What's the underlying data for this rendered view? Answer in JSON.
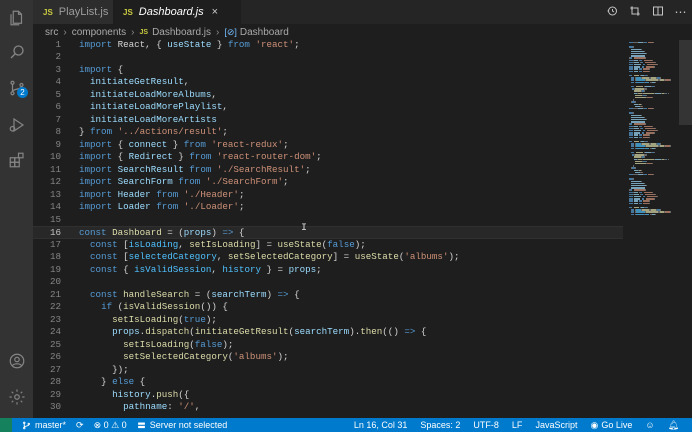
{
  "tabs": [
    {
      "icon": "JS",
      "label": "PlayList.js"
    },
    {
      "icon": "JS",
      "label": "Dashboard.js",
      "close": "×"
    }
  ],
  "breadcrumb": {
    "parts": [
      "src",
      "components"
    ],
    "file_icon": "JS",
    "file": "Dashboard.js",
    "symbol": "Dashboard"
  },
  "activity_bar": {
    "icons": [
      "files-icon",
      "search-icon",
      "source-control-icon",
      "run-debug-icon",
      "extensions-icon",
      "accounts-icon",
      "settings-gear-icon"
    ],
    "scm_badge": "2"
  },
  "editor": {
    "current_line": 16,
    "lines": [
      {
        "n": "1",
        "tokens": [
          [
            "k",
            "import"
          ],
          [
            "p",
            " React, { "
          ],
          [
            "v",
            "useState"
          ],
          [
            "p",
            " } "
          ],
          [
            "k",
            "from"
          ],
          [
            "p",
            " "
          ],
          [
            "s",
            "'react'"
          ],
          [
            "p",
            ";"
          ]
        ]
      },
      {
        "n": "2",
        "tokens": []
      },
      {
        "n": "3",
        "tokens": [
          [
            "k",
            "import"
          ],
          [
            "p",
            " {"
          ]
        ]
      },
      {
        "n": "4",
        "tokens": [
          [
            "p",
            "  "
          ],
          [
            "v",
            "initiateGetResult"
          ],
          [
            "p",
            ","
          ]
        ]
      },
      {
        "n": "5",
        "tokens": [
          [
            "p",
            "  "
          ],
          [
            "v",
            "initiateLoadMoreAlbums"
          ],
          [
            "p",
            ","
          ]
        ]
      },
      {
        "n": "6",
        "tokens": [
          [
            "p",
            "  "
          ],
          [
            "v",
            "initiateLoadMorePlaylist"
          ],
          [
            "p",
            ","
          ]
        ]
      },
      {
        "n": "7",
        "tokens": [
          [
            "p",
            "  "
          ],
          [
            "v",
            "initiateLoadMoreArtists"
          ]
        ]
      },
      {
        "n": "8",
        "tokens": [
          [
            "p",
            "} "
          ],
          [
            "k",
            "from"
          ],
          [
            "p",
            " "
          ],
          [
            "s",
            "'../actions/result'"
          ],
          [
            "p",
            ";"
          ]
        ]
      },
      {
        "n": "9",
        "tokens": [
          [
            "k",
            "import"
          ],
          [
            "p",
            " { "
          ],
          [
            "v",
            "connect"
          ],
          [
            "p",
            " } "
          ],
          [
            "k",
            "from"
          ],
          [
            "p",
            " "
          ],
          [
            "s",
            "'react-redux'"
          ],
          [
            "p",
            ";"
          ]
        ]
      },
      {
        "n": "10",
        "tokens": [
          [
            "k",
            "import"
          ],
          [
            "p",
            " { "
          ],
          [
            "v",
            "Redirect"
          ],
          [
            "p",
            " } "
          ],
          [
            "k",
            "from"
          ],
          [
            "p",
            " "
          ],
          [
            "s",
            "'react-router-dom'"
          ],
          [
            "p",
            ";"
          ]
        ]
      },
      {
        "n": "11",
        "tokens": [
          [
            "k",
            "import"
          ],
          [
            "p",
            " "
          ],
          [
            "v",
            "SearchResult"
          ],
          [
            "p",
            " "
          ],
          [
            "k",
            "from"
          ],
          [
            "p",
            " "
          ],
          [
            "s",
            "'./SearchResult'"
          ],
          [
            "p",
            ";"
          ]
        ]
      },
      {
        "n": "12",
        "tokens": [
          [
            "k",
            "import"
          ],
          [
            "p",
            " "
          ],
          [
            "v",
            "SearchForm"
          ],
          [
            "p",
            " "
          ],
          [
            "k",
            "from"
          ],
          [
            "p",
            " "
          ],
          [
            "s",
            "'./SearchForm'"
          ],
          [
            "p",
            ";"
          ]
        ]
      },
      {
        "n": "13",
        "tokens": [
          [
            "k",
            "import"
          ],
          [
            "p",
            " "
          ],
          [
            "v",
            "Header"
          ],
          [
            "p",
            " "
          ],
          [
            "k",
            "from"
          ],
          [
            "p",
            " "
          ],
          [
            "s",
            "'./Header'"
          ],
          [
            "p",
            ";"
          ]
        ]
      },
      {
        "n": "14",
        "tokens": [
          [
            "k",
            "import"
          ],
          [
            "p",
            " "
          ],
          [
            "v",
            "Loader"
          ],
          [
            "p",
            " "
          ],
          [
            "k",
            "from"
          ],
          [
            "p",
            " "
          ],
          [
            "s",
            "'./Loader'"
          ],
          [
            "p",
            ";"
          ]
        ]
      },
      {
        "n": "15",
        "tokens": []
      },
      {
        "n": "16",
        "tokens": [
          [
            "k",
            "const"
          ],
          [
            "p",
            " "
          ],
          [
            "f",
            "Dashboard"
          ],
          [
            "p",
            " = ("
          ],
          [
            "v",
            "props"
          ],
          [
            "p",
            ") "
          ],
          [
            "k",
            "=>"
          ],
          [
            "p",
            " {"
          ]
        ]
      },
      {
        "n": "17",
        "tokens": [
          [
            "p",
            "  "
          ],
          [
            "k",
            "const"
          ],
          [
            "p",
            " ["
          ],
          [
            "c",
            "isLoading"
          ],
          [
            "p",
            ", "
          ],
          [
            "f",
            "setIsLoading"
          ],
          [
            "p",
            "] = "
          ],
          [
            "f",
            "useState"
          ],
          [
            "p",
            "("
          ],
          [
            "k",
            "false"
          ],
          [
            "p",
            ");"
          ]
        ]
      },
      {
        "n": "18",
        "tokens": [
          [
            "p",
            "  "
          ],
          [
            "k",
            "const"
          ],
          [
            "p",
            " ["
          ],
          [
            "c",
            "selectedCategory"
          ],
          [
            "p",
            ", "
          ],
          [
            "f",
            "setSelectedCategory"
          ],
          [
            "p",
            "] = "
          ],
          [
            "f",
            "useState"
          ],
          [
            "p",
            "("
          ],
          [
            "s",
            "'albums'"
          ],
          [
            "p",
            ");"
          ]
        ]
      },
      {
        "n": "19",
        "tokens": [
          [
            "p",
            "  "
          ],
          [
            "k",
            "const"
          ],
          [
            "p",
            " { "
          ],
          [
            "c",
            "isValidSession"
          ],
          [
            "p",
            ", "
          ],
          [
            "c",
            "history"
          ],
          [
            "p",
            " } = "
          ],
          [
            "v",
            "props"
          ],
          [
            "p",
            ";"
          ]
        ]
      },
      {
        "n": "20",
        "tokens": []
      },
      {
        "n": "21",
        "tokens": [
          [
            "p",
            "  "
          ],
          [
            "k",
            "const"
          ],
          [
            "p",
            " "
          ],
          [
            "f",
            "handleSearch"
          ],
          [
            "p",
            " = ("
          ],
          [
            "v",
            "searchTerm"
          ],
          [
            "p",
            ") "
          ],
          [
            "k",
            "=>"
          ],
          [
            "p",
            " {"
          ]
        ]
      },
      {
        "n": "22",
        "tokens": [
          [
            "p",
            "    "
          ],
          [
            "k",
            "if"
          ],
          [
            "p",
            " ("
          ],
          [
            "f",
            "isValidSession"
          ],
          [
            "p",
            "()) {"
          ]
        ]
      },
      {
        "n": "23",
        "tokens": [
          [
            "p",
            "      "
          ],
          [
            "f",
            "setIsLoading"
          ],
          [
            "p",
            "("
          ],
          [
            "k",
            "true"
          ],
          [
            "p",
            ");"
          ]
        ]
      },
      {
        "n": "24",
        "tokens": [
          [
            "p",
            "      "
          ],
          [
            "v",
            "props"
          ],
          [
            "p",
            "."
          ],
          [
            "f",
            "dispatch"
          ],
          [
            "p",
            "("
          ],
          [
            "f",
            "initiateGetResult"
          ],
          [
            "p",
            "("
          ],
          [
            "v",
            "searchTerm"
          ],
          [
            "p",
            ")."
          ],
          [
            "f",
            "then"
          ],
          [
            "p",
            "(() "
          ],
          [
            "k",
            "=>"
          ],
          [
            "p",
            " {"
          ]
        ]
      },
      {
        "n": "25",
        "tokens": [
          [
            "p",
            "        "
          ],
          [
            "f",
            "setIsLoading"
          ],
          [
            "p",
            "("
          ],
          [
            "k",
            "false"
          ],
          [
            "p",
            ");"
          ]
        ]
      },
      {
        "n": "26",
        "tokens": [
          [
            "p",
            "        "
          ],
          [
            "f",
            "setSelectedCategory"
          ],
          [
            "p",
            "("
          ],
          [
            "s",
            "'albums'"
          ],
          [
            "p",
            ");"
          ]
        ]
      },
      {
        "n": "27",
        "tokens": [
          [
            "p",
            "      });"
          ]
        ]
      },
      {
        "n": "28",
        "tokens": [
          [
            "p",
            "    } "
          ],
          [
            "k",
            "else"
          ],
          [
            "p",
            " {"
          ]
        ]
      },
      {
        "n": "29",
        "tokens": [
          [
            "p",
            "      "
          ],
          [
            "v",
            "history"
          ],
          [
            "p",
            "."
          ],
          [
            "f",
            "push"
          ],
          [
            "p",
            "({"
          ]
        ]
      },
      {
        "n": "30",
        "tokens": [
          [
            "p",
            "        "
          ],
          [
            "v",
            "pathname"
          ],
          [
            "p",
            ": "
          ],
          [
            "s",
            "'/'"
          ],
          [
            "p",
            ","
          ]
        ]
      }
    ]
  },
  "status_bar": {
    "branch": "master*",
    "problems": "⊗ 0 ⚠ 0",
    "server": "Server not selected",
    "position": "Ln 16, Col 31",
    "spaces": "Spaces: 2",
    "encoding": "UTF-8",
    "eol": "LF",
    "language": "JavaScript",
    "go_live": "Go Live"
  },
  "colors": {
    "status_bar": "#007acc",
    "activity_bar": "#333333",
    "editor_bg": "#1e1e1e",
    "keyword": "#569cd6",
    "string": "#ce9178",
    "function": "#dcdcaa",
    "variable": "#9cdcfe"
  }
}
